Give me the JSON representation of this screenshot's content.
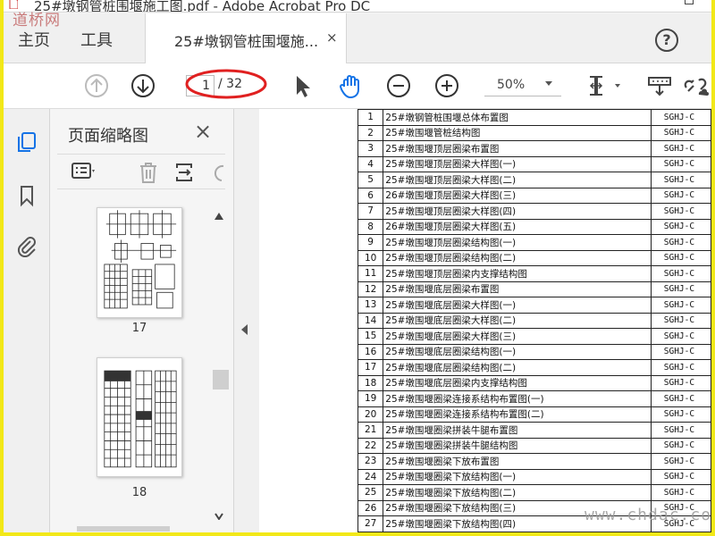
{
  "window": {
    "title": "25#墩钢管桩围堰施工图.pdf - Adobe Acrobat Pro DC",
    "watermark_top_left": "道桥网",
    "watermark_bottom_right": "www.chdac.com"
  },
  "tabs": {
    "home": "主页",
    "tools": "工具",
    "document": "25#墩钢管桩围堰施...",
    "close_glyph": "×",
    "help_glyph": "?"
  },
  "toolbar": {
    "page_current": "1",
    "page_total": "/ 32",
    "zoom": "50%",
    "accent_annotation_color": "#e02020"
  },
  "sidebar": {
    "title": "页面缩略图",
    "close_glyph": "×",
    "thumbnails": [
      {
        "label": "17"
      },
      {
        "label": "18"
      }
    ]
  },
  "colors": {
    "frame_border": "#f2e818",
    "icon_gray": "#555555",
    "active_rail": "#1473e6"
  },
  "document": {
    "rows": [
      {
        "n": "1",
        "title": "25#墩钢管桩围堰总体布置图",
        "code": "SGHJ-C"
      },
      {
        "n": "2",
        "title": "25#墩围堰管桩结构图",
        "code": "SGHJ-C"
      },
      {
        "n": "3",
        "title": "25#墩围堰顶层圈梁布置图",
        "code": "SGHJ-C"
      },
      {
        "n": "4",
        "title": "25#墩围堰顶层圈梁大样图(一)",
        "code": "SGHJ-C"
      },
      {
        "n": "5",
        "title": "25#墩围堰顶层圈梁大样图(二)",
        "code": "SGHJ-C"
      },
      {
        "n": "6",
        "title": "26#墩围堰顶层圈梁大样图(三)",
        "code": "SGHJ-C"
      },
      {
        "n": "7",
        "title": "25#墩围堰顶层圈梁大样图(四)",
        "code": "SGHJ-C"
      },
      {
        "n": "8",
        "title": "26#墩围堰顶层圈梁大样图(五)",
        "code": "SGHJ-C"
      },
      {
        "n": "9",
        "title": "25#墩围堰顶层圈梁结构图(一)",
        "code": "SGHJ-C"
      },
      {
        "n": "10",
        "title": "25#墩围堰顶层圈梁结构图(二)",
        "code": "SGHJ-C"
      },
      {
        "n": "11",
        "title": "25#墩围堰顶层圈梁内支撑结构图",
        "code": "SGHJ-C"
      },
      {
        "n": "12",
        "title": "25#墩围堰底层圈梁布置图",
        "code": "SGHJ-C"
      },
      {
        "n": "13",
        "title": "25#墩围堰底层圈梁大样图(一)",
        "code": "SGHJ-C"
      },
      {
        "n": "14",
        "title": "25#墩围堰底层圈梁大样图(二)",
        "code": "SGHJ-C"
      },
      {
        "n": "15",
        "title": "25#墩围堰底层圈梁大样图(三)",
        "code": "SGHJ-C"
      },
      {
        "n": "16",
        "title": "25#墩围堰底层圈梁结构图(一)",
        "code": "SGHJ-C"
      },
      {
        "n": "17",
        "title": "25#墩围堰底层圈梁结构图(二)",
        "code": "SGHJ-C"
      },
      {
        "n": "18",
        "title": "25#墩围堰底层圈梁内支撑结构图",
        "code": "SGHJ-C"
      },
      {
        "n": "19",
        "title": "25#墩围堰圈梁连接系结构布置图(一)",
        "code": "SGHJ-C"
      },
      {
        "n": "20",
        "title": "25#墩围堰圈梁连接系结构布置图(二)",
        "code": "SGHJ-C"
      },
      {
        "n": "21",
        "title": "25#墩围堰圈梁拼装牛腿布置图",
        "code": "SGHJ-C"
      },
      {
        "n": "22",
        "title": "25#墩围堰圈梁拼装牛腿结构图",
        "code": "SGHJ-C"
      },
      {
        "n": "23",
        "title": "25#墩围堰圈梁下放布置图",
        "code": "SGHJ-C"
      },
      {
        "n": "24",
        "title": "25#墩围堰圈梁下放结构图(一)",
        "code": "SGHJ-C"
      },
      {
        "n": "25",
        "title": "25#墩围堰圈梁下放结构图(二)",
        "code": "SGHJ-C"
      },
      {
        "n": "26",
        "title": "25#墩围堰圈梁下放结构图(三)",
        "code": "SGHJ-C"
      },
      {
        "n": "27",
        "title": "25#墩围堰圈梁下放结构图(四)",
        "code": "SGHJ-C"
      }
    ]
  }
}
